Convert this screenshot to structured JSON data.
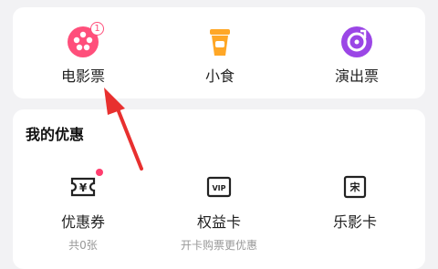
{
  "services": [
    {
      "label": "电影票",
      "icon": "film-reel-icon",
      "badge": "1"
    },
    {
      "label": "小食",
      "icon": "drink-cup-icon"
    },
    {
      "label": "演出票",
      "icon": "music-disc-icon"
    }
  ],
  "benefits": {
    "title": "我的优惠",
    "items": [
      {
        "label": "优惠券",
        "sub": "共0张",
        "icon": "coupon-ticket-icon"
      },
      {
        "label": "权益卡",
        "sub": "开卡购票更优惠",
        "icon": "vip-card-icon"
      },
      {
        "label": "乐影卡",
        "sub": "",
        "icon": "movie-card-icon"
      }
    ]
  },
  "icon_text": {
    "coupon": "¥",
    "vip": "VIP",
    "movie_card": "宋"
  },
  "colors": {
    "film": "#ff4f7b",
    "drink": "#ffa726",
    "music": "#9b46e6",
    "arrow": "#e8302f"
  }
}
